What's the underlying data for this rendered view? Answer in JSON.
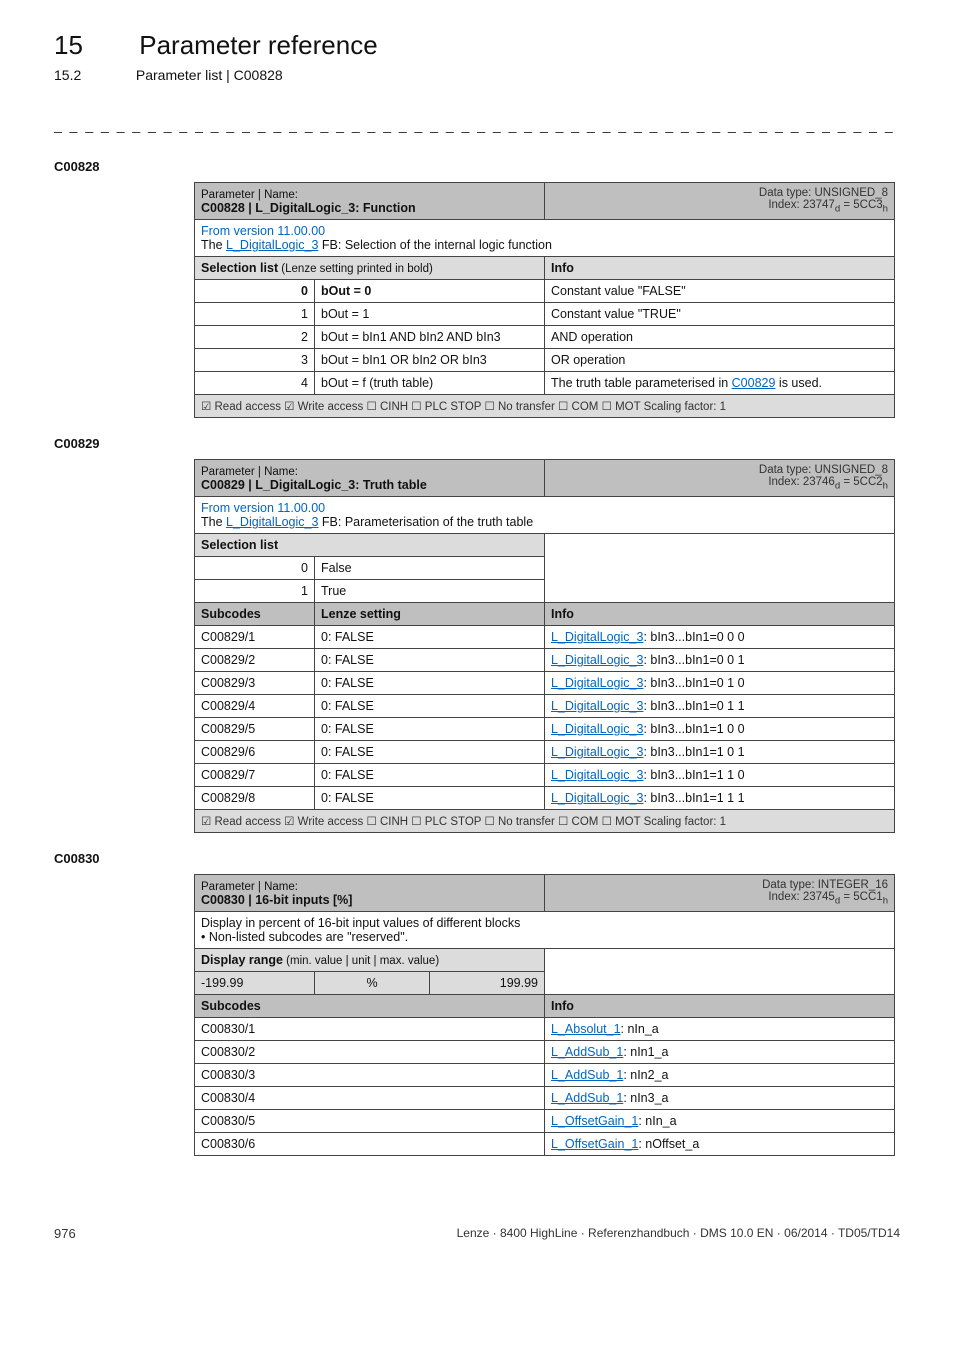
{
  "header": {
    "chapter_num": "15",
    "chapter_title": "Parameter reference",
    "sub_num": "15.2",
    "sub_title": "Parameter list | C00828"
  },
  "dashes": "_ _ _ _ _ _ _ _ _ _ _ _ _ _ _ _ _ _ _ _ _ _ _ _ _ _ _ _ _ _ _ _ _ _ _ _ _ _ _ _ _ _ _ _ _ _ _ _ _ _ _ _ _ _ _ _ _ _ _ _ _ _ _ _",
  "t1": {
    "code": "C00828",
    "pn_label": "Parameter | Name:",
    "pn_value": "C00828 | L_DigitalLogic_3: Function",
    "dt1": "Data type: UNSIGNED_8",
    "dt2": "Index: 23747",
    "dt2_sub": "d",
    "dt2_eq": " = 5CC3",
    "dt2_subh": "h",
    "ver": "From version 11.00.00",
    "desc_a": "The ",
    "desc_link": "L_DigitalLogic_3",
    "desc_b": " FB: Selection of the internal logic function",
    "sel_label": "Selection list",
    "sel_hint": " (Lenze setting printed in bold)",
    "info_label": "Info",
    "rows": [
      {
        "n": "0",
        "l": "bOut = 0",
        "i": "Constant value \"FALSE\"",
        "bold": true
      },
      {
        "n": "1",
        "l": "bOut = 1",
        "i": "Constant value \"TRUE\""
      },
      {
        "n": "2",
        "l": "bOut = bIn1 AND bIn2 AND bIn3",
        "i": "AND operation"
      },
      {
        "n": "3",
        "l": "bOut = bIn1 OR bIn2 OR bIn3",
        "i": "OR operation"
      },
      {
        "n": "4",
        "l": "bOut = f (truth table)",
        "i_pre": "The truth table parameterised in ",
        "i_link": "C00829",
        "i_post": "  is used."
      }
    ],
    "foot": "☑ Read access   ☑ Write access   ☐ CINH   ☐ PLC STOP   ☐ No transfer   ☐ COM   ☐ MOT     Scaling factor: 1"
  },
  "t2": {
    "code": "C00829",
    "pn_label": "Parameter | Name:",
    "pn_value": "C00829 | L_DigitalLogic_3: Truth table",
    "dt1": "Data type: UNSIGNED_8",
    "dt2": "Index: 23746",
    "dt2_sub": "d",
    "dt2_eq": " = 5CC2",
    "dt2_subh": "h",
    "ver": "From version 11.00.00",
    "desc_a": "The ",
    "desc_link": "L_DigitalLogic_3",
    "desc_b": " FB: Parameterisation of the truth table",
    "sel_label": "Selection list",
    "r0_n": "0",
    "r0_l": "False",
    "r1_n": "1",
    "r1_l": "True",
    "sub_label": "Subcodes",
    "lenze_label": "Lenze setting",
    "info_label": "Info",
    "rows": [
      {
        "s": "C00829/1",
        "v": "0: FALSE",
        "li": "L_DigitalLogic_3",
        "t": ": bIn3...bIn1=0 0 0"
      },
      {
        "s": "C00829/2",
        "v": "0: FALSE",
        "li": "L_DigitalLogic_3",
        "t": ": bIn3...bIn1=0 0 1"
      },
      {
        "s": "C00829/3",
        "v": "0: FALSE",
        "li": "L_DigitalLogic_3",
        "t": ": bIn3...bIn1=0 1 0"
      },
      {
        "s": "C00829/4",
        "v": "0: FALSE",
        "li": "L_DigitalLogic_3",
        "t": ": bIn3...bIn1=0 1 1"
      },
      {
        "s": "C00829/5",
        "v": "0: FALSE",
        "li": "L_DigitalLogic_3",
        "t": ": bIn3...bIn1=1 0 0"
      },
      {
        "s": "C00829/6",
        "v": "0: FALSE",
        "li": "L_DigitalLogic_3",
        "t": ": bIn3...bIn1=1 0 1"
      },
      {
        "s": "C00829/7",
        "v": "0: FALSE",
        "li": "L_DigitalLogic_3",
        "t": ": bIn3...bIn1=1 1 0"
      },
      {
        "s": "C00829/8",
        "v": "0: FALSE",
        "li": "L_DigitalLogic_3",
        "t": ": bIn3...bIn1=1 1 1"
      }
    ],
    "foot": "☑ Read access   ☑ Write access   ☐ CINH   ☐ PLC STOP   ☐ No transfer   ☐ COM   ☐ MOT     Scaling factor: 1"
  },
  "t3": {
    "code": "C00830",
    "pn_label": "Parameter | Name:",
    "pn_value": "C00830 | 16-bit inputs [%]",
    "dt1": "Data type: INTEGER_16",
    "dt2": "Index: 23745",
    "dt2_sub": "d",
    "dt2_eq": " = 5CC1",
    "dt2_subh": "h",
    "desc1": "Display in percent of 16-bit input values of different blocks",
    "desc2": " • Non-listed subcodes are \"reserved\".",
    "range_label": "Display range",
    "range_hint": " (min. value | unit | max. value)",
    "min": "-199.99",
    "unit": "%",
    "max": "199.99",
    "sub_label": "Subcodes",
    "info_label": "Info",
    "rows": [
      {
        "s": "C00830/1",
        "li": "L_Absolut_1",
        "t": ": nIn_a"
      },
      {
        "s": "C00830/2",
        "li": "L_AddSub_1",
        "t": ": nIn1_a"
      },
      {
        "s": "C00830/3",
        "li": "L_AddSub_1",
        "t": ": nIn2_a"
      },
      {
        "s": "C00830/4",
        "li": "L_AddSub_1",
        "t": ": nIn3_a"
      },
      {
        "s": "C00830/5",
        "li": "L_OffsetGain_1",
        "t": ": nIn_a"
      },
      {
        "s": "C00830/6",
        "li": "L_OffsetGain_1",
        "t": ": nOffset_a"
      }
    ]
  },
  "footer": {
    "page": "976",
    "right": "Lenze · 8400 HighLine · Referenzhandbuch · DMS 10.0 EN · 06/2014 · TD05/TD14"
  }
}
